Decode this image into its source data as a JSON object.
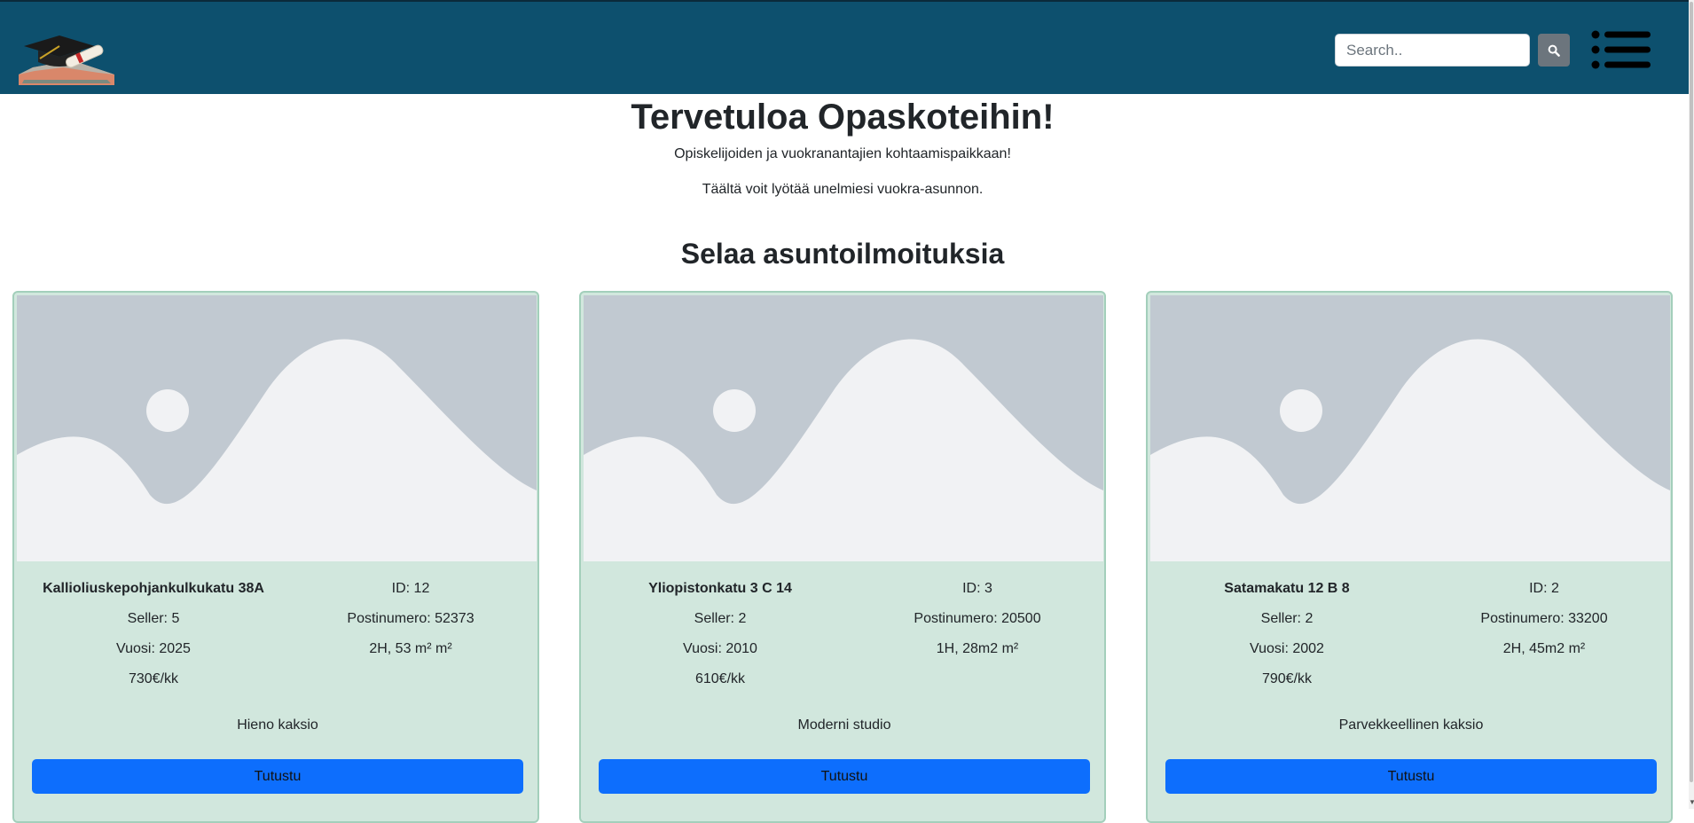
{
  "header": {
    "logo_icon": "graduation-cap-icon",
    "search_placeholder": "Search..",
    "search_value": "",
    "search_icon": "search-icon",
    "menu_icon": "list-menu-icon",
    "brand_color": "#0d506e"
  },
  "hero": {
    "title": "Tervetuloa Opaskoteihin!",
    "subtitle": "Opiskelijoiden ja vuokranantajien kohtaamispaikkaan!",
    "subtitle2": "Täältä voit lyötää unelmiesi vuokra-asunnon."
  },
  "listings_title": "Selaa asuntoilmoituksia",
  "listings": [
    {
      "address": "Kallioliuskepohjankulkukatu 38A",
      "seller": "Seller: 5",
      "year": "Vuosi: 2025",
      "price": "730€/kk",
      "id": "ID: 12",
      "postal": "Postinumero: 52373",
      "size": "2H, 53 m² m²",
      "description": "Hieno kaksio",
      "button": "Tutustu"
    },
    {
      "address": "Yliopistonkatu 3 C 14",
      "seller": "Seller: 2",
      "year": "Vuosi: 2010",
      "price": "610€/kk",
      "id": "ID: 3",
      "postal": "Postinumero: 20500",
      "size": "1H, 28m2 m²",
      "description": "Moderni studio",
      "button": "Tutustu"
    },
    {
      "address": "Satamakatu 12 B 8",
      "seller": "Seller: 2",
      "year": "Vuosi: 2002",
      "price": "790€/kk",
      "id": "ID: 2",
      "postal": "Postinumero: 33200",
      "size": "2H, 45m2 m²",
      "description": "Parvekkeellinen kaksio",
      "button": "Tutustu"
    }
  ],
  "colors": {
    "card_bg": "#d1e7dd",
    "card_border": "#a3cfbb",
    "button": "#0d6efd",
    "placeholder_bg": "#c1c9d1",
    "placeholder_fg": "#f1f2f4"
  }
}
